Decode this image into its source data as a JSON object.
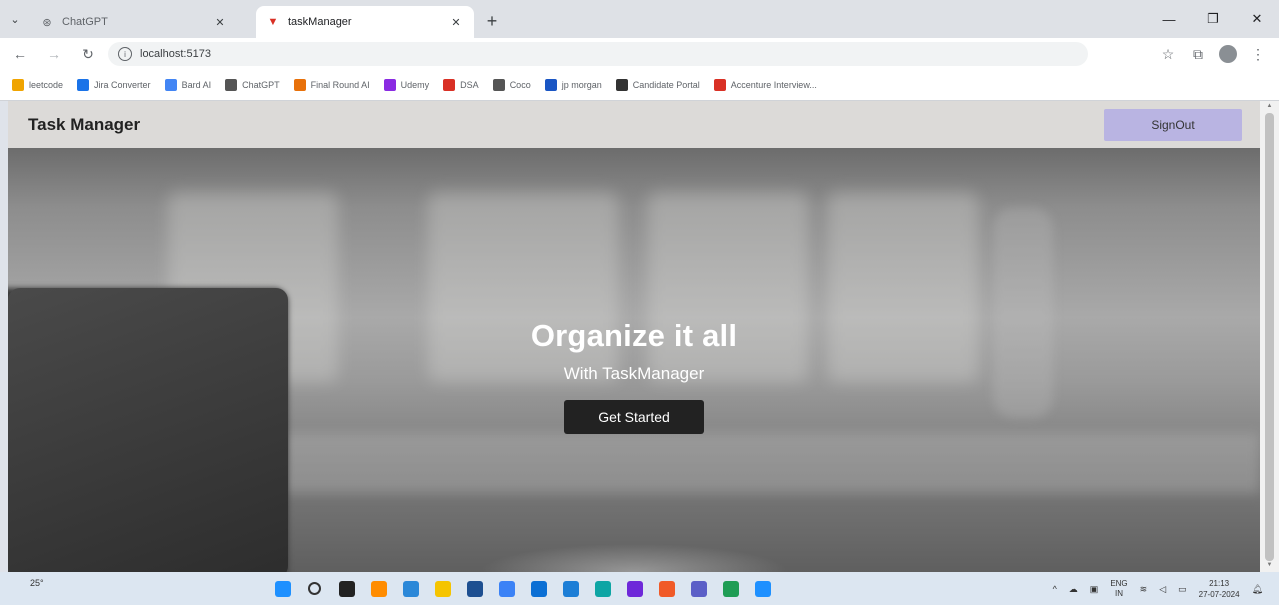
{
  "browser": {
    "tabs": [
      {
        "title": "ChatGPT",
        "active": false
      },
      {
        "title": "taskManager",
        "active": true
      }
    ],
    "address": "localhost:5173",
    "bookmarks": [
      {
        "label": "leetcode",
        "color": "#f0a400"
      },
      {
        "label": "Jira Converter",
        "color": "#1a73e8"
      },
      {
        "label": "Bard AI",
        "color": "#4285f4"
      },
      {
        "label": "ChatGPT",
        "color": "#555555"
      },
      {
        "label": "Final Round AI",
        "color": "#e8710a"
      },
      {
        "label": "Udemy",
        "color": "#8a2be2"
      },
      {
        "label": "DSA",
        "color": "#d93025"
      },
      {
        "label": "Coco",
        "color": "#555555"
      },
      {
        "label": "jp morgan",
        "color": "#1a56c4"
      },
      {
        "label": "Candidate Portal",
        "color": "#333333"
      },
      {
        "label": "Accenture Interview...",
        "color": "#d93025"
      }
    ]
  },
  "app": {
    "brand": "Task Manager",
    "signout_label": "SignOut",
    "hero": {
      "title": "Organize it all",
      "subtitle": "With TaskManager",
      "cta_label": "Get Started"
    }
  },
  "taskbar": {
    "weather": "25°",
    "language": "ENG",
    "region": "IN",
    "time": "21:13",
    "date": "27-07-2024",
    "app_colors": [
      "#1e90ff",
      "#333333",
      "#222222",
      "#ff8c00",
      "#2b88d8",
      "#f5c400",
      "#1d4f91",
      "#3b82f6",
      "#0b6fd4",
      "#1c7ed6",
      "#0ea5a4",
      "#6d28d9",
      "#f05a28",
      "#5b5fc7",
      "#1f9d55",
      "#1e90ff"
    ]
  }
}
